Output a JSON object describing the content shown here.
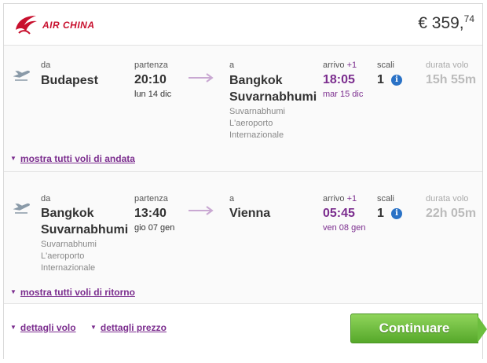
{
  "airline": {
    "name": "AIR CHINA",
    "brand_color": "#c8102e"
  },
  "price": {
    "main": "€ 359,",
    "cents": "74"
  },
  "labels": {
    "from": "da",
    "departure": "partenza",
    "to": "a",
    "arrival": "arrivo",
    "stops": "scali",
    "duration": "durata volo"
  },
  "outbound": {
    "plane_icon": "plane-takeoff-icon",
    "from_city": "Budapest",
    "dep_time": "20:10",
    "dep_date": "lun 14 dic",
    "to_city_line1": "Bangkok",
    "to_city_line2": "Suvarnabhumi",
    "to_airport_lines": [
      "Suvarnabhumi",
      "L'aeroporto",
      "Internazionale"
    ],
    "arr_plus": "+1",
    "arr_time": "18:05",
    "arr_date": "mar 15 dic",
    "stops": "1",
    "duration": "15h 55m",
    "show_all_link": "mostra tutti voli di andata"
  },
  "return": {
    "plane_icon": "plane-takeoff-icon",
    "from_city_line1": "Bangkok",
    "from_city_line2": "Suvarnabhumi",
    "from_airport_lines": [
      "Suvarnabhumi",
      "L'aeroporto",
      "Internazionale"
    ],
    "dep_time": "13:40",
    "dep_date": "gio 07 gen",
    "to_city": "Vienna",
    "arr_plus": "+1",
    "arr_time": "05:45",
    "arr_date": "ven 08 gen",
    "stops": "1",
    "duration": "22h 05m",
    "show_all_link": "mostra tutti voli di ritorno"
  },
  "footer": {
    "flight_details": "dettagli volo",
    "price_details": "dettagli prezzo",
    "continue_button": "Continuare"
  },
  "colors": {
    "accent_purple": "#7b2d8e",
    "info_blue": "#2a72c6",
    "button_green": "#56a82a"
  }
}
